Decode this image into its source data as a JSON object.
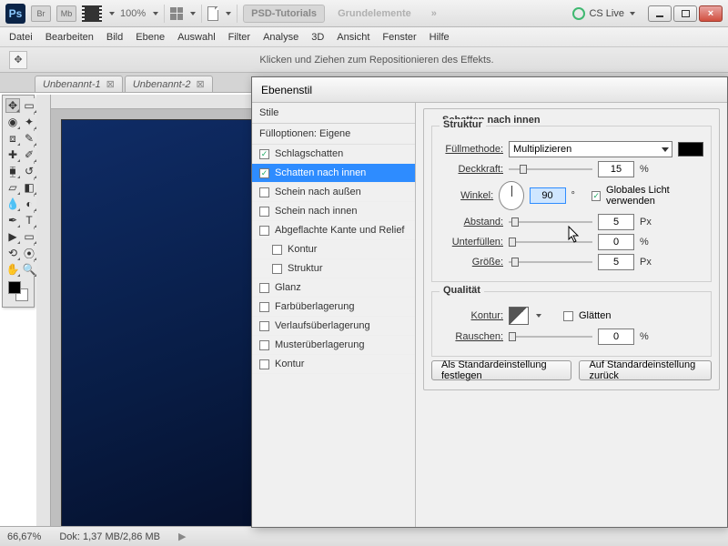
{
  "appbar": {
    "zoom": "100%",
    "btns": [
      "PSD-Tutorials",
      "Grundelemente"
    ],
    "cs": "CS Live",
    "badges": [
      "Br",
      "Mb"
    ]
  },
  "menu": [
    "Datei",
    "Bearbeiten",
    "Bild",
    "Ebene",
    "Auswahl",
    "Filter",
    "Analyse",
    "3D",
    "Ansicht",
    "Fenster",
    "Hilfe"
  ],
  "optbar": "Klicken und Ziehen zum Repositionieren des Effekts.",
  "tabs": [
    "Unbenannt-1",
    "Unbenannt-2"
  ],
  "status": {
    "zoom": "66,67%",
    "doc": "Dok: 1,37 MB/2,86 MB"
  },
  "dialog": {
    "title": "Ebenenstil",
    "stylesHead": "Stile",
    "fillHead": "Fülloptionen: Eigene",
    "styles": [
      {
        "label": "Schlagschatten",
        "checked": true,
        "sel": false
      },
      {
        "label": "Schatten nach innen",
        "checked": true,
        "sel": true
      },
      {
        "label": "Schein nach außen",
        "checked": false,
        "sel": false
      },
      {
        "label": "Schein nach innen",
        "checked": false,
        "sel": false
      },
      {
        "label": "Abgeflachte Kante und Relief",
        "checked": false,
        "sel": false
      },
      {
        "label": "Kontur",
        "checked": false,
        "sel": false,
        "sub": true
      },
      {
        "label": "Struktur",
        "checked": false,
        "sel": false,
        "sub": true
      },
      {
        "label": "Glanz",
        "checked": false,
        "sel": false
      },
      {
        "label": "Farbüberlagerung",
        "checked": false,
        "sel": false
      },
      {
        "label": "Verlaufsüberlagerung",
        "checked": false,
        "sel": false
      },
      {
        "label": "Musterüberlagerung",
        "checked": false,
        "sel": false
      },
      {
        "label": "Kontur",
        "checked": false,
        "sel": false
      }
    ],
    "section": "Schatten nach innen",
    "struktur": "Struktur",
    "quality": "Qualität",
    "labels": {
      "blend": "Füllmethode:",
      "opacity": "Deckkraft:",
      "angle": "Winkel:",
      "global": "Globales Licht verwenden",
      "distance": "Abstand:",
      "choke": "Unterfüllen:",
      "size": "Größe:",
      "contour": "Kontur:",
      "aa": "Glätten",
      "noise": "Rauschen:"
    },
    "values": {
      "blend": "Multiplizieren",
      "opacity": "15",
      "angle": "90",
      "distance": "5",
      "choke": "0",
      "size": "5",
      "noise": "0"
    },
    "units": {
      "pct": "%",
      "px": "Px",
      "deg": "°"
    },
    "buttons": {
      "setDefault": "Als Standardeinstellung festlegen",
      "resetDefault": "Auf Standardeinstellung zurück"
    }
  }
}
